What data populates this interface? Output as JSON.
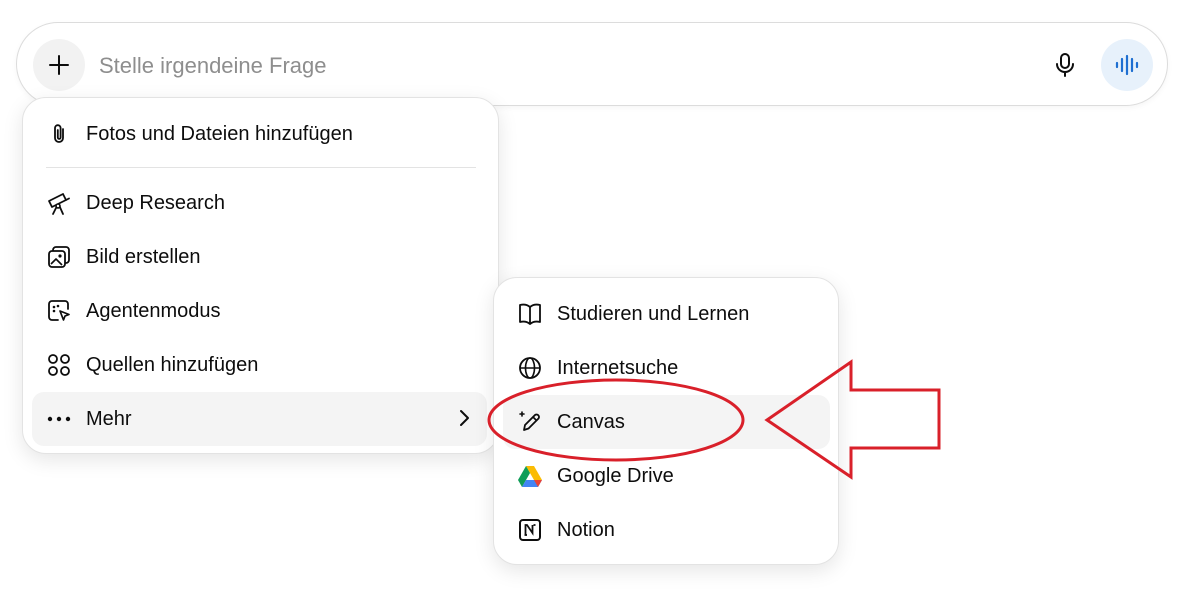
{
  "composer": {
    "placeholder": "Stelle irgendeine Frage"
  },
  "menu": {
    "items": [
      {
        "label": "Fotos und Dateien hinzufügen",
        "icon": "paperclip-icon"
      },
      {
        "label": "Deep Research",
        "icon": "telescope-icon"
      },
      {
        "label": "Bild erstellen",
        "icon": "image-create-icon"
      },
      {
        "label": "Agentenmodus",
        "icon": "agent-cursor-icon"
      },
      {
        "label": "Quellen hinzufügen",
        "icon": "sources-nodes-icon"
      },
      {
        "label": "Mehr",
        "icon": "more-dots-icon"
      }
    ]
  },
  "submenu": {
    "items": [
      {
        "label": "Studieren und Lernen",
        "icon": "open-book-icon"
      },
      {
        "label": "Internetsuche",
        "icon": "globe-icon"
      },
      {
        "label": "Canvas",
        "icon": "pencil-sparkle-icon"
      },
      {
        "label": "Google Drive",
        "icon": "google-drive-icon"
      },
      {
        "label": "Notion",
        "icon": "notion-icon"
      }
    ]
  },
  "colors": {
    "accent_voice_bg": "#e7f1fb",
    "annotation_red": "#d9202a",
    "hover_bg": "#f4f4f4"
  }
}
